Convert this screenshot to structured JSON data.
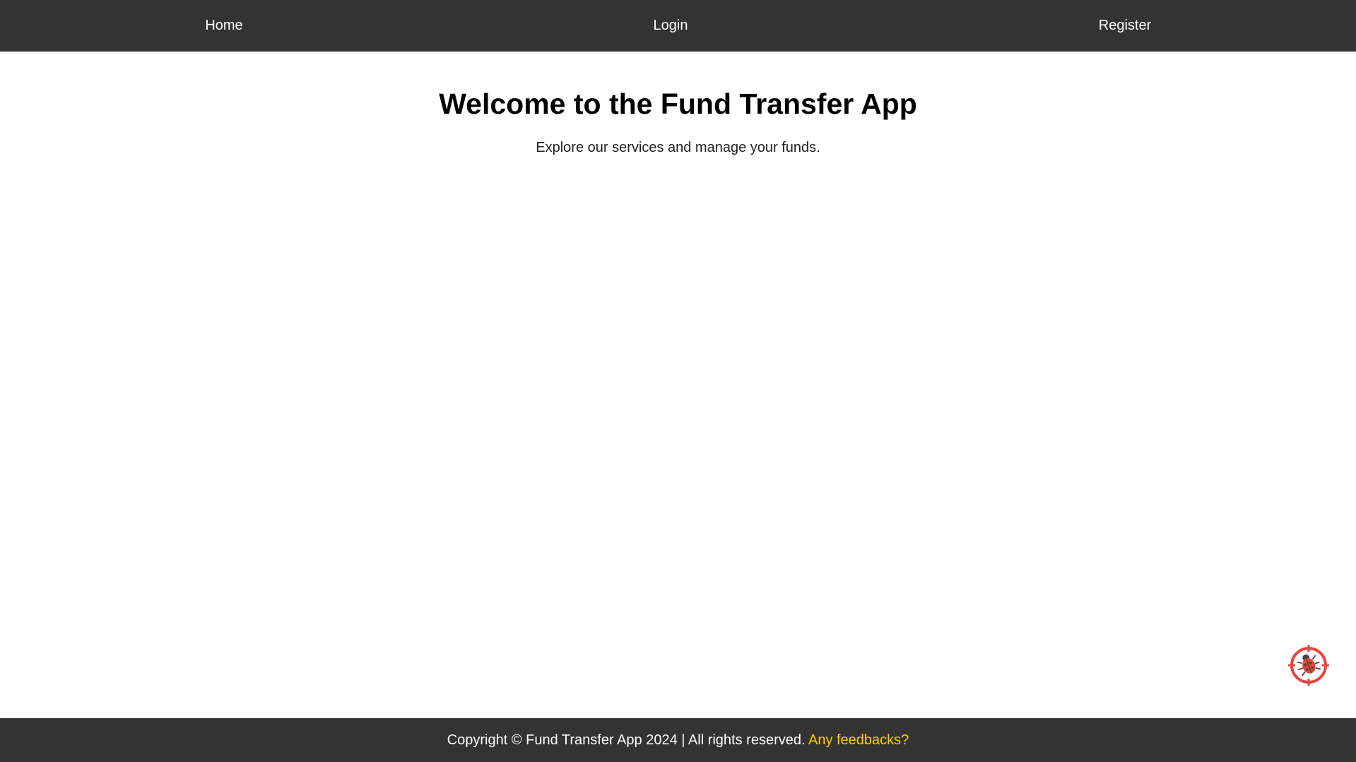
{
  "nav": {
    "home": "Home",
    "login": "Login",
    "register": "Register"
  },
  "hero": {
    "title": "Welcome to the Fund Transfer App",
    "subtitle": "Explore our services and manage your funds."
  },
  "footer": {
    "copyright": "Copyright © Fund Transfer App 2024 | All rights reserved.",
    "feedback_link": "Any feedbacks?"
  },
  "widget": {
    "icon": "bug-report-icon"
  },
  "colors": {
    "nav_bg": "#333333",
    "footer_bg": "#333333",
    "link_accent": "#ffcc00",
    "widget_red": "#e8453c"
  }
}
